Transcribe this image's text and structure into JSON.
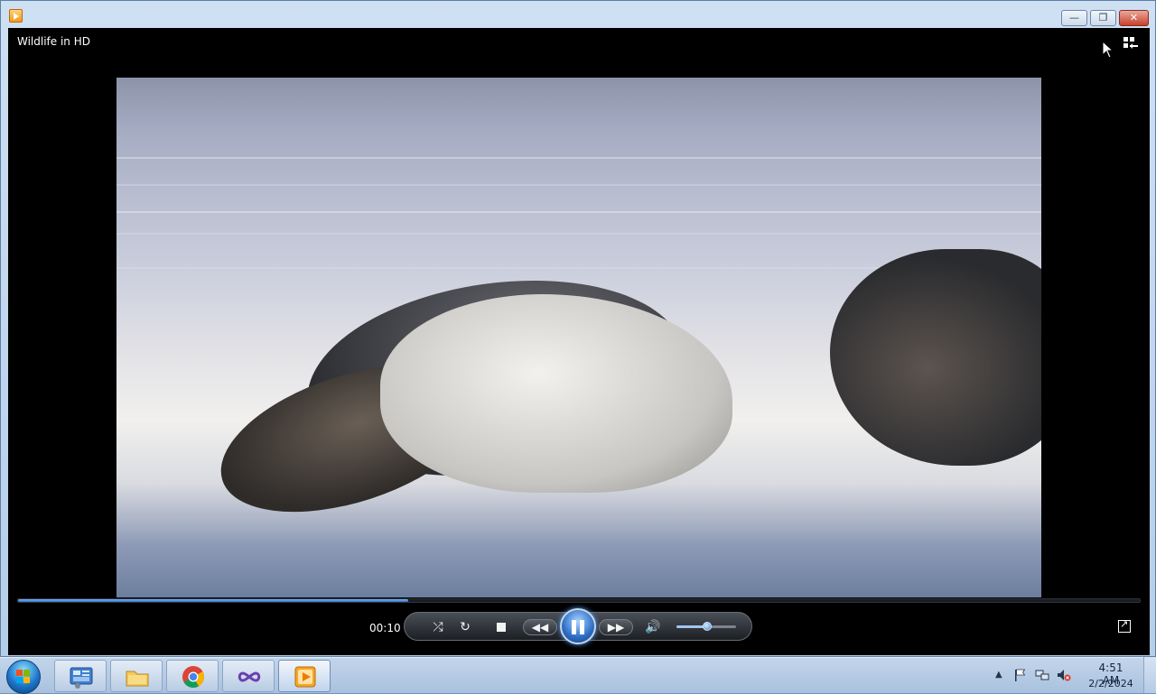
{
  "window": {
    "title_icon": "media-player-icon",
    "minimize_icon": "minimize-icon",
    "maximize_icon": "restore-icon",
    "close_icon": "close-icon"
  },
  "player": {
    "video_title": "Wildlife in HD",
    "elapsed": "00:10",
    "progress_fraction": 0.348,
    "volume_fraction": 0.52,
    "state": "playing"
  },
  "controls": {
    "shuffle_icon": "shuffle-icon",
    "repeat_icon": "repeat-icon",
    "stop_icon": "stop-icon",
    "previous_icon": "previous-icon",
    "pause_icon": "pause-icon",
    "next_icon": "next-icon",
    "volume_icon": "volume-icon",
    "fullscreen_icon": "fullscreen-icon",
    "switch_library_icon": "switch-to-library-icon"
  },
  "taskbar": {
    "pinned": [
      {
        "name": "control-panel",
        "icon": "control-panel-icon"
      },
      {
        "name": "file-explorer",
        "icon": "folder-icon"
      },
      {
        "name": "chrome",
        "icon": "chrome-icon"
      },
      {
        "name": "visual-studio",
        "icon": "infinity-icon"
      },
      {
        "name": "media-player",
        "icon": "media-player-icon",
        "active": true
      }
    ],
    "tray": {
      "clock_time": "4:51 AM",
      "clock_date": "2/2/2024"
    }
  },
  "colors": {
    "accent": "#2f6ec6",
    "player_bg": "#000000",
    "taskbar": "#b6cce6",
    "close_red": "#c7412c"
  }
}
